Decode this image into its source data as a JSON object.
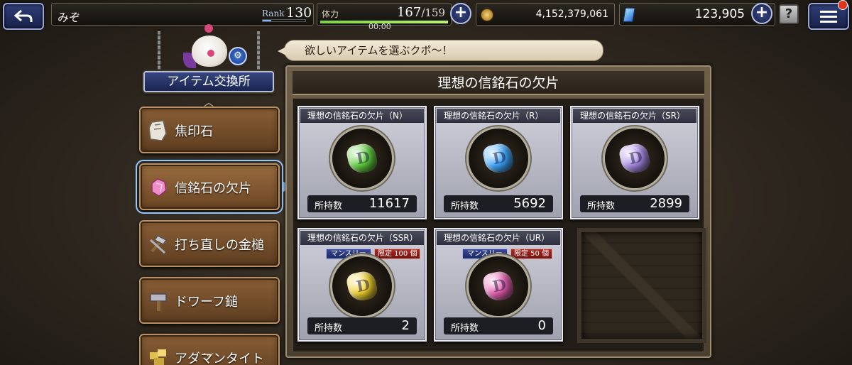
{
  "topbar": {
    "player_name": "みぞ",
    "rank_label": "Rank",
    "rank_value": "130",
    "rank_progress": 0.2,
    "stamina_label": "体力",
    "stamina_current": "167",
    "stamina_max": "/159",
    "stamina_timer": "00:00",
    "stamina_progress": 1.0,
    "gil_value": "4,152,379,061",
    "gem_value": "123,905",
    "help_label": "?",
    "plus_label": "+"
  },
  "shop": {
    "title": "アイテム交換所",
    "speech": "欲しいアイテムを選ぶクポ〜！"
  },
  "menu": {
    "items": [
      {
        "label": "焦印石",
        "icon": "stone-icon"
      },
      {
        "label": "信銘石の欠片",
        "icon": "pink-crystal-icon"
      },
      {
        "label": "打ち直しの金槌",
        "icon": "hammer-icon"
      },
      {
        "label": "ドワーフ鎚",
        "icon": "dwarf-hammer-icon"
      },
      {
        "label": "アダマンタイト",
        "icon": "adamantite-icon"
      }
    ],
    "selected_index": 1
  },
  "panel": {
    "title": "理想の信銘石の欠片",
    "count_label": "所持数",
    "cards": [
      {
        "title": "理想の信銘石の欠片（N）",
        "count": "11617",
        "color": "#5fd13a"
      },
      {
        "title": "理想の信銘石の欠片（R）",
        "count": "5692",
        "color": "#3aa6ff"
      },
      {
        "title": "理想の信銘石の欠片（SR）",
        "count": "2899",
        "color": "#a98ae8"
      },
      {
        "title": "理想の信銘石の欠片（SSR）",
        "count": "2",
        "color": "#f2d02a",
        "tag_monthly": "マンスリー",
        "tag_limit": "限定 100 個"
      },
      {
        "title": "理想の信銘石の欠片（UR）",
        "count": "0",
        "color": "#e85db0",
        "tag_monthly": "マンスリー",
        "tag_limit": "限定 50 個"
      }
    ]
  },
  "colors": {
    "accent_blue": "#8fc8ff",
    "stamina_green": "#7bd43b"
  }
}
